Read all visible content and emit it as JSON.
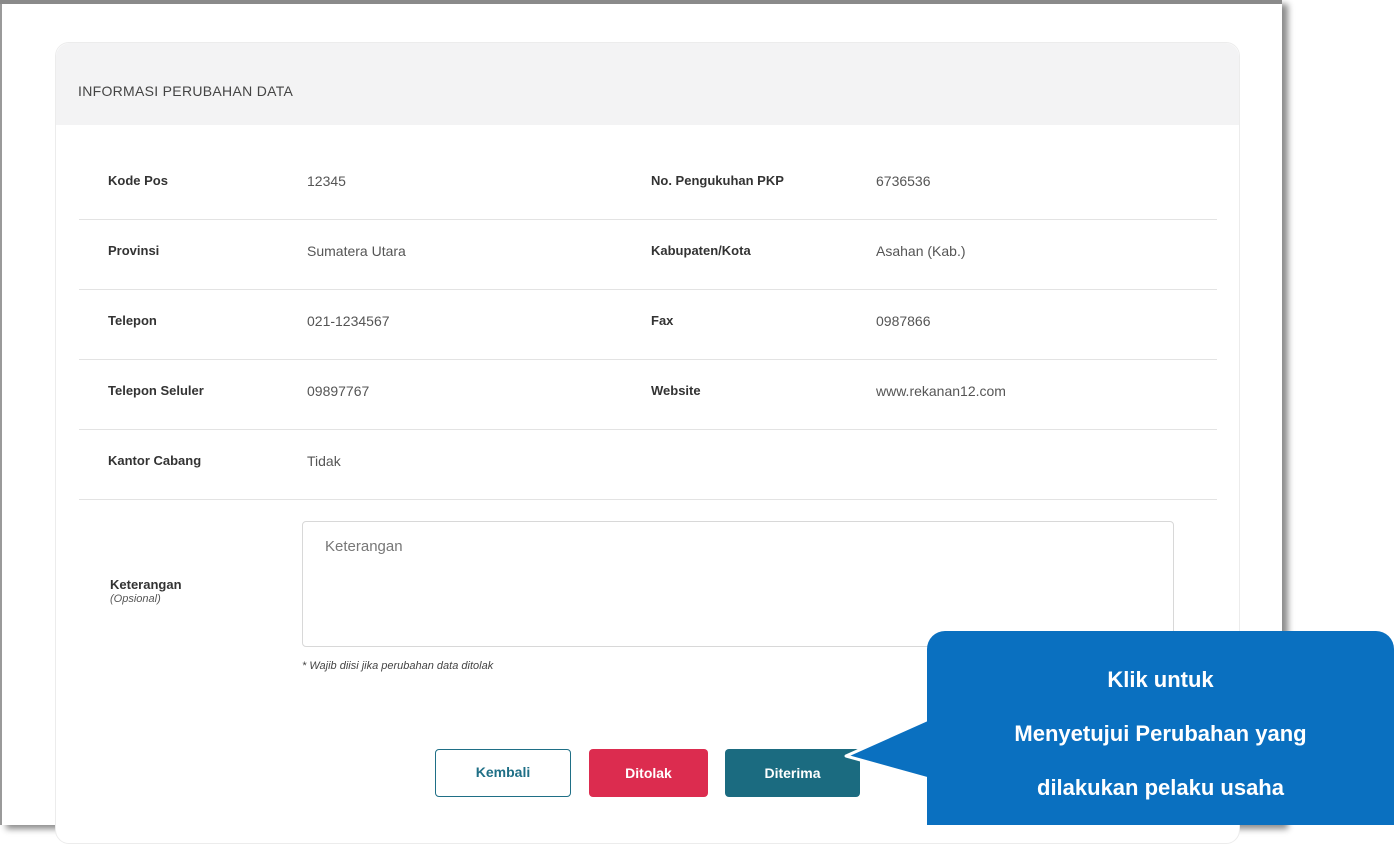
{
  "header": {
    "title": "INFORMASI PERUBAHAN DATA"
  },
  "rows": [
    {
      "l1": "Kode Pos",
      "v1": "12345",
      "l2": "No. Pengukuhan PKP",
      "v2": "6736536"
    },
    {
      "l1": "Provinsi",
      "v1": "Sumatera Utara",
      "l2": "Kabupaten/Kota",
      "v2": "Asahan (Kab.)"
    },
    {
      "l1": "Telepon",
      "v1": "021-1234567",
      "l2": "Fax",
      "v2": "0987866"
    },
    {
      "l1": "Telepon Seluler",
      "v1": "09897767",
      "l2": "Website",
      "v2": "www.rekanan12.com"
    },
    {
      "l1": "Kantor Cabang",
      "v1": "Tidak",
      "l2": "",
      "v2": ""
    }
  ],
  "keterangan": {
    "label": "Keterangan",
    "sublabel": "(Opsional)",
    "placeholder": "Keterangan",
    "value": "",
    "hint": "* Wajib diisi jika perubahan data ditolak"
  },
  "buttons": {
    "kembali": "Kembali",
    "ditolak": "Ditolak",
    "diterima": "Diterima"
  },
  "callout": {
    "line1": "Klik untuk",
    "line2": "Menyetujui Perubahan yang",
    "line3": "dilakukan pelaku usaha"
  },
  "colors": {
    "callout": "#0a70c0",
    "ditolak": "#dc2c4f",
    "diterima": "#1b6b80",
    "kembali_border": "#1f6f86"
  }
}
